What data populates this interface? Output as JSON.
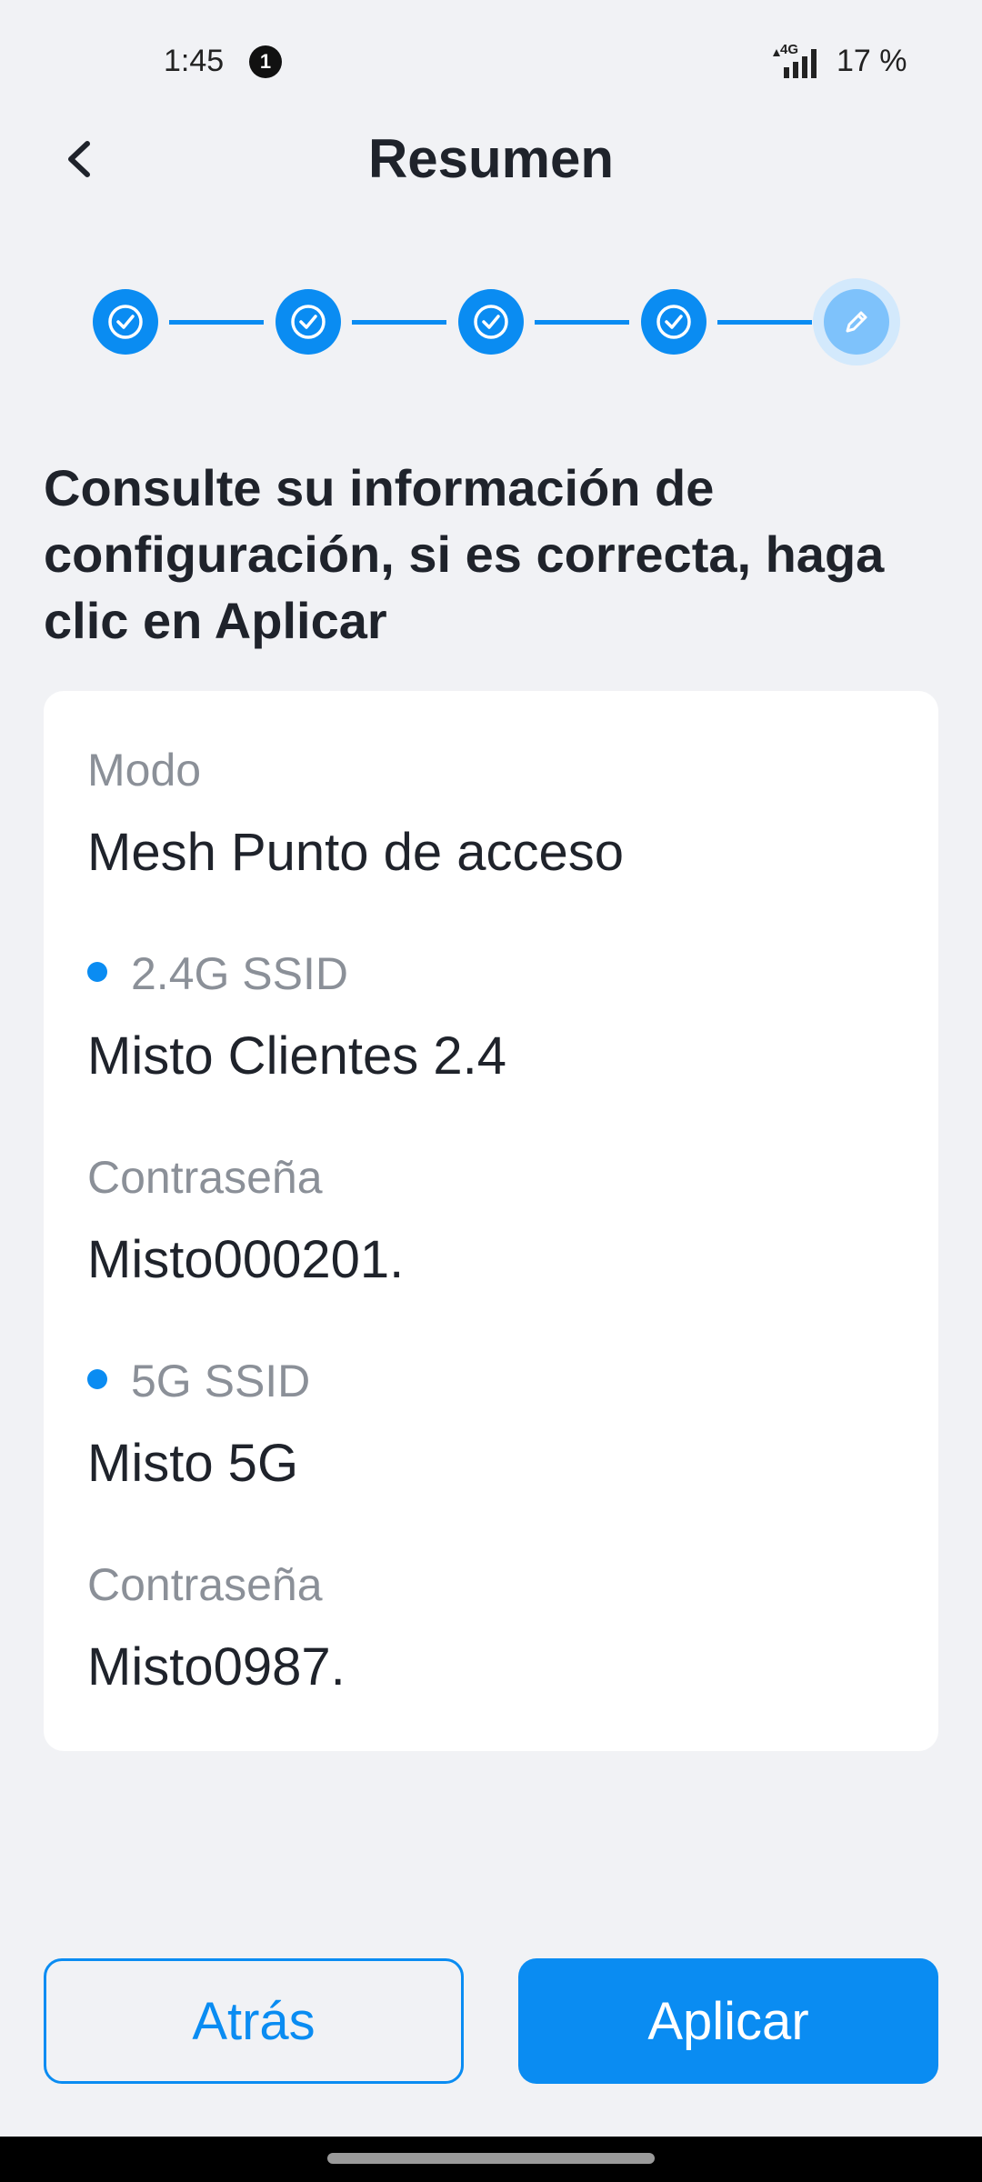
{
  "status_bar": {
    "time": "1:45",
    "notification_count": "1",
    "network": "4G",
    "battery": "17 %"
  },
  "header": {
    "title": "Resumen",
    "back_icon": "chevron-left-icon"
  },
  "stepper": {
    "total_steps": 5,
    "completed_steps": 4,
    "current_icon": "pencil-icon",
    "completed_icon": "check-circle-icon"
  },
  "instructions": "Consulte su información de configuración, si es correcta, haga clic en Aplicar",
  "summary": {
    "mode_label": "Modo",
    "mode_value": "Mesh Punto de acceso",
    "ssid_24_label": "2.4G SSID",
    "ssid_24_value": "Misto Clientes 2.4",
    "password_24_label": "Contraseña",
    "password_24_value": "Misto000201.",
    "ssid_5_label": "5G SSID",
    "ssid_5_value": "Misto 5G",
    "password_5_label": "Contraseña",
    "password_5_value": "Misto0987."
  },
  "actions": {
    "back_label": "Atrás",
    "apply_label": "Aplicar"
  },
  "colors": {
    "accent": "#0a8cf2",
    "background": "#f1f2f5",
    "card": "#ffffff",
    "label": "#8b9098",
    "text": "#1f232b"
  }
}
